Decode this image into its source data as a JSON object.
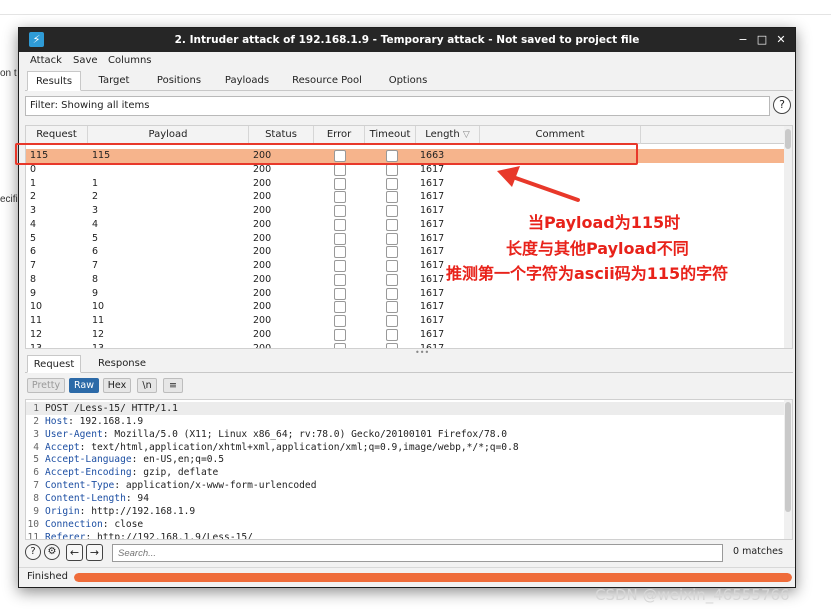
{
  "background": {
    "fragment_1": "on t",
    "fragment_2": "ecifi"
  },
  "window": {
    "title": "2. Intruder attack of 192.168.1.9 - Temporary attack - Not saved to project file",
    "controls": [
      "−",
      "□",
      "✕"
    ]
  },
  "menu": [
    "Attack",
    "Save",
    "Columns"
  ],
  "tabs": [
    "Results",
    "Target",
    "Positions",
    "Payloads",
    "Resource Pool",
    "Options"
  ],
  "filter": {
    "text": "Filter: Showing all items",
    "help": "?"
  },
  "table": {
    "headers": [
      "Request",
      "Payload",
      "Status",
      "Error",
      "Timeout",
      "Length",
      "Comment"
    ],
    "sort_indicator": "▽",
    "rows": [
      {
        "request": "115",
        "payload": "115",
        "status": "200",
        "length": "1663",
        "highlight": true
      },
      {
        "request": "0",
        "payload": "",
        "status": "200",
        "length": "1617"
      },
      {
        "request": "1",
        "payload": "1",
        "status": "200",
        "length": "1617"
      },
      {
        "request": "2",
        "payload": "2",
        "status": "200",
        "length": "1617"
      },
      {
        "request": "3",
        "payload": "3",
        "status": "200",
        "length": "1617"
      },
      {
        "request": "4",
        "payload": "4",
        "status": "200",
        "length": "1617"
      },
      {
        "request": "5",
        "payload": "5",
        "status": "200",
        "length": "1617"
      },
      {
        "request": "6",
        "payload": "6",
        "status": "200",
        "length": "1617"
      },
      {
        "request": "7",
        "payload": "7",
        "status": "200",
        "length": "1617"
      },
      {
        "request": "8",
        "payload": "8",
        "status": "200",
        "length": "1617"
      },
      {
        "request": "9",
        "payload": "9",
        "status": "200",
        "length": "1617"
      },
      {
        "request": "10",
        "payload": "10",
        "status": "200",
        "length": "1617"
      },
      {
        "request": "11",
        "payload": "11",
        "status": "200",
        "length": "1617"
      },
      {
        "request": "12",
        "payload": "12",
        "status": "200",
        "length": "1617"
      },
      {
        "request": "13",
        "payload": "13",
        "status": "200",
        "length": "1617"
      }
    ]
  },
  "annotation": {
    "line1": "当Payload为115时",
    "line2": "长度与其他Payload不同",
    "line3": "推测第一个字符为ascii码为115的字符",
    "color": "#e8221a"
  },
  "request_tabs": [
    "Request",
    "Response"
  ],
  "format_buttons": [
    "Pretty",
    "Raw",
    "Hex",
    "\\n",
    "≡"
  ],
  "request_lines": [
    {
      "n": "1",
      "key": "",
      "val": "POST /Less-15/ HTTP/1.1"
    },
    {
      "n": "2",
      "key": "Host",
      "val": ": 192.168.1.9"
    },
    {
      "n": "3",
      "key": "User-Agent",
      "val": ": Mozilla/5.0 (X11; Linux x86_64; rv:78.0) Gecko/20100101 Firefox/78.0"
    },
    {
      "n": "4",
      "key": "Accept",
      "val": ": text/html,application/xhtml+xml,application/xml;q=0.9,image/webp,*/*;q=0.8"
    },
    {
      "n": "5",
      "key": "Accept-Language",
      "val": ": en-US,en;q=0.5"
    },
    {
      "n": "6",
      "key": "Accept-Encoding",
      "val": ": gzip, deflate"
    },
    {
      "n": "7",
      "key": "Content-Type",
      "val": ": application/x-www-form-urlencoded"
    },
    {
      "n": "8",
      "key": "Content-Length",
      "val": ": 94"
    },
    {
      "n": "9",
      "key": "Origin",
      "val": ": http://192.168.1.9"
    },
    {
      "n": "10",
      "key": "Connection",
      "val": ": close"
    },
    {
      "n": "11",
      "key": "Referer",
      "val": ": http://192.168.1.9/Less-15/"
    }
  ],
  "search": {
    "placeholder": "Search...",
    "matches": "0 matches"
  },
  "status": {
    "text": "Finished",
    "progress": 1.0
  },
  "watermark": "CSDN @weixin_46555766"
}
